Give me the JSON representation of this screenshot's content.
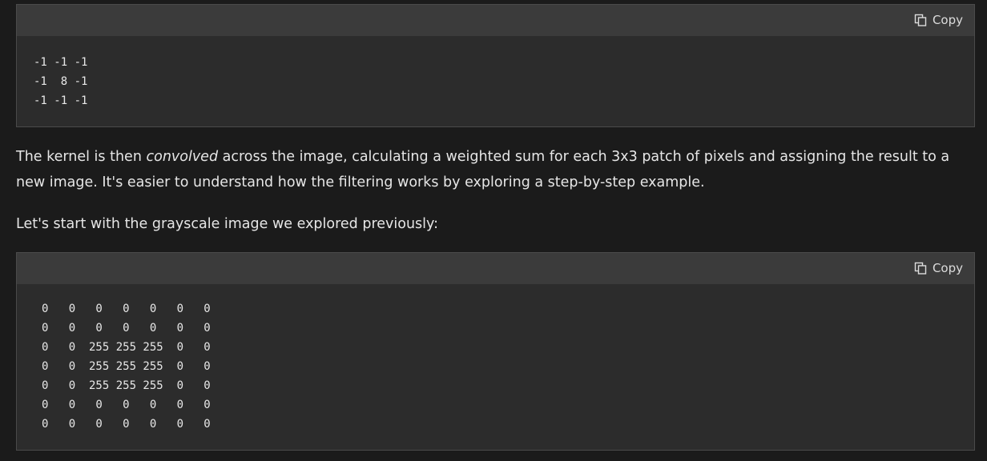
{
  "code_block_1": {
    "copy_label": "Copy",
    "code": "-1 -1 -1\n-1  8 -1\n-1 -1 -1"
  },
  "paragraph_1": {
    "before": "The kernel is then ",
    "emphasis": "convolved",
    "after": " across the image, calculating a weighted sum for each 3x3 patch of pixels and assigning the result to a new image. It's easier to understand how the filtering works by exploring a step-by-step example."
  },
  "paragraph_2": {
    "text": "Let's start with the grayscale image we explored previously:"
  },
  "code_block_2": {
    "copy_label": "Copy",
    "code": "0   0   0   0   0   0   0\n0   0   0   0   0   0   0\n0   0  255 255 255  0   0\n0   0  255 255 255  0   0\n0   0  255 255 255  0   0\n0   0   0   0   0   0   0\n0   0   0   0   0   0   0"
  }
}
